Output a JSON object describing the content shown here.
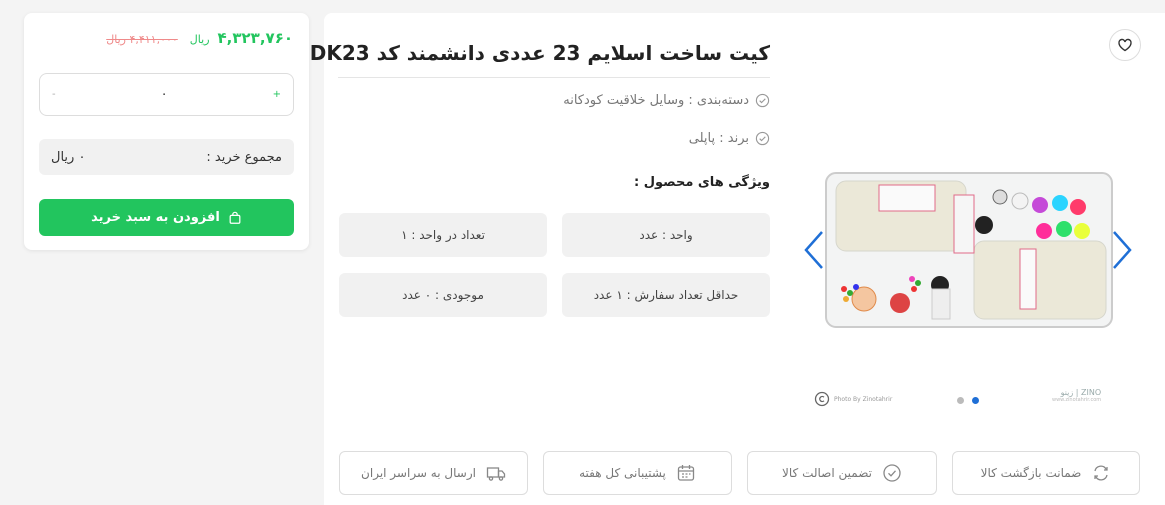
{
  "buy_card": {
    "price_new": "۴,۳۲۳,۷۶۰",
    "price_unit": "ریال",
    "price_old": "۴,۴۱۱,۰۰۰ ریال",
    "qty_minus": "-",
    "qty_value": "۰",
    "qty_plus": "+",
    "total_label": "مجموع خرید :",
    "total_value": "۰ ریال",
    "add_to_cart_label": "افزودن به سبد خرید"
  },
  "product": {
    "title": "کیت ساخت اسلایم 23 عددی دانشمند کد DK23",
    "category_text": "دسته‌بندی : وسایل خلاقیت کودکانه",
    "brand_text": "برند : پاپلی",
    "features_title": "ویژگی های محصول :",
    "features": [
      "واحد : عدد",
      "تعداد در واحد : ۱",
      "حداقل تعداد سفارش : ۱ عدد",
      "موجودی : ۰ عدد"
    ]
  },
  "gallery": {
    "copyright_text": "Photo By Zinotahrir",
    "watermark_text": "زینو | ZINO",
    "watermark_url": "www.zinotahrir.com",
    "active_slide": 1,
    "slide_count": 2
  },
  "guarantees": [
    {
      "label": "ضمانت بازگشت کالا",
      "icon": "return-icon"
    },
    {
      "label": "تضمین اصالت کالا",
      "icon": "check-circle-icon"
    },
    {
      "label": "پشتیبانی کل هفته",
      "icon": "calendar-icon"
    },
    {
      "label": "ارسال به سراسر ایران",
      "icon": "truck-icon"
    }
  ],
  "colors": {
    "accent_green": "#22c55e",
    "old_price_red": "#ef8a8a",
    "slider_blue": "#1f6fd6"
  }
}
